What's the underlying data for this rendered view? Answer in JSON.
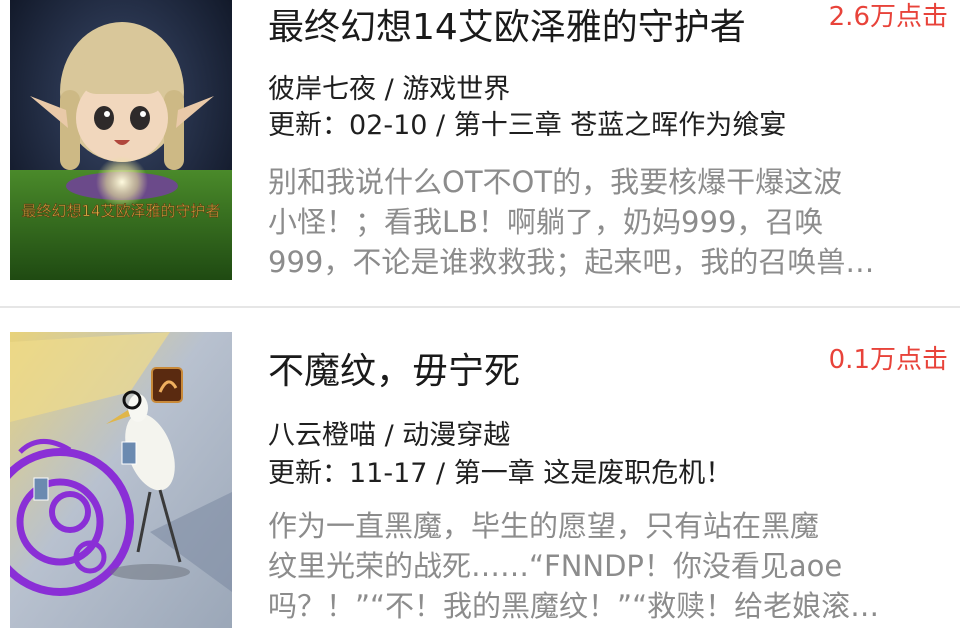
{
  "books": [
    {
      "title": "最终幻想14艾欧泽雅的守护者",
      "clicks": "2.6万点击",
      "author_category": "彼岸七夜 / 游戏世界",
      "update": "更新：02-10 / 第十三章 苍蓝之晖作为飨宴",
      "desc_lines": [
        "别和我说什么OT不OT的，我要核爆干爆这波",
        "小怪！；看我LB！啊躺了，奶妈999，召唤",
        "999，不论是谁救救我；起来吧，我的召唤兽…"
      ],
      "cover_caption": "最终幻想14艾欧泽雅的守护者"
    },
    {
      "title": "不魔纹，毋宁死",
      "clicks": "0.1万点击",
      "author_category": "八云橙喵 / 动漫穿越",
      "update": "更新：11-17 / 第一章 这是废职危机！",
      "desc_lines": [
        "作为一直黑魔，毕生的愿望，只有站在黑魔",
        "纹里光荣的战死……“FNNDP！你没看见aoe",
        "吗？！”“不！我的黑魔纹！”“救赎！给老娘滚…"
      ]
    }
  ],
  "colors": {
    "clicks": "#e8433a",
    "title": "#1a1a1a",
    "desc": "#8c8c8c",
    "divider": "#e6e6e6"
  }
}
